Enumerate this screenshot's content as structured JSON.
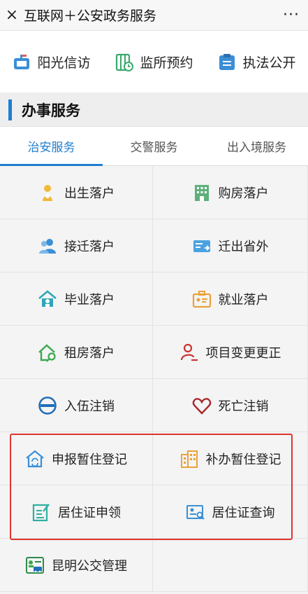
{
  "topbar": {
    "close": "×",
    "title": "互联网＋公安政务服务",
    "more": "···"
  },
  "quick": [
    {
      "label": "阳光信访",
      "icon": "mailbox-icon"
    },
    {
      "label": "监所预约",
      "icon": "jail-clock-icon"
    },
    {
      "label": "执法公开",
      "icon": "document-list-icon"
    }
  ],
  "section": {
    "title": "办事服务"
  },
  "tabs": [
    "治安服务",
    "交警服务",
    "出入境服务"
  ],
  "services": [
    {
      "label": "出生落户",
      "icon": "baby-icon"
    },
    {
      "label": "购房落户",
      "icon": "building-icon"
    },
    {
      "label": "接迁落户",
      "icon": "users-icon"
    },
    {
      "label": "迁出省外",
      "icon": "id-card-out-icon"
    },
    {
      "label": "毕业落户",
      "icon": "home-graduate-icon"
    },
    {
      "label": "就业落户",
      "icon": "briefcase-card-icon"
    },
    {
      "label": "租房落户",
      "icon": "home-key-icon"
    },
    {
      "label": "项目变更更正",
      "icon": "user-edit-icon"
    },
    {
      "label": "入伍注销",
      "icon": "no-entry-icon"
    },
    {
      "label": "死亡注销",
      "icon": "heart-icon"
    },
    {
      "label": "申报暂住登记",
      "icon": "home-refresh-icon"
    },
    {
      "label": "补办暂住登记",
      "icon": "apartment-icon"
    },
    {
      "label": "居住证申领",
      "icon": "form-edit-icon"
    },
    {
      "label": "居住证查询",
      "icon": "card-search-icon"
    },
    {
      "label": "昆明公交管理",
      "icon": "bus-card-icon"
    }
  ],
  "colors": {
    "accent": "#1f7ed0",
    "highlight": "#e0342e"
  }
}
